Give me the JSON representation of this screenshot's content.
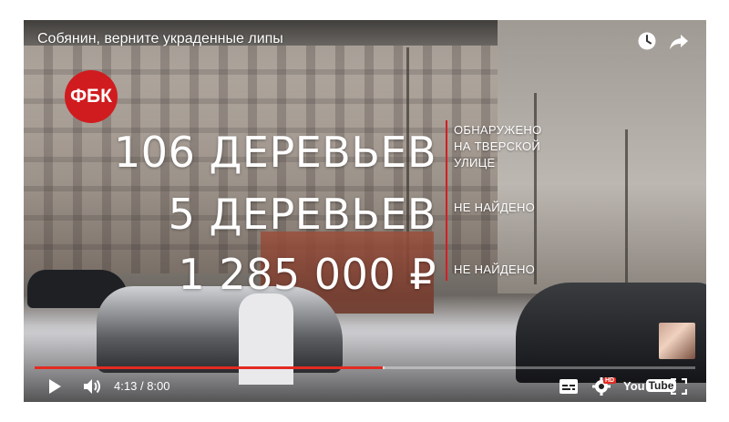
{
  "video": {
    "title": "Собянин, верните украденные липы",
    "logo_text": "ФБК",
    "stats": [
      {
        "value": "106 ДЕРЕВЬЕВ",
        "note_lines": [
          "ОБНАРУЖЕНО",
          "НА ТВЕРСКОЙ",
          "УЛИЦЕ"
        ]
      },
      {
        "value": "5 ДЕРЕВЬЕВ",
        "note_lines": [
          "НЕ НАЙДЕНО"
        ]
      },
      {
        "value": "1 285 000 ₽",
        "note_lines": [
          "НЕ НАЙДЕНО"
        ]
      }
    ]
  },
  "player": {
    "current_time": "4:13",
    "time_separator": "/",
    "duration": "8:00",
    "progress_fraction": 0.527,
    "buffered_fraction": 0.53,
    "quality_badge": "HD",
    "logo_you": "You",
    "logo_tube": "Tube",
    "icons": {
      "watch_later": "clock-icon",
      "share": "share-icon",
      "play": "play-icon",
      "volume": "volume-icon",
      "subtitles": "subtitles-icon",
      "settings": "gear-icon",
      "fullscreen": "fullscreen-icon"
    }
  },
  "colors": {
    "accent": "#e32b22",
    "logo_red": "#d01c1f",
    "divider": "#d21e24"
  }
}
